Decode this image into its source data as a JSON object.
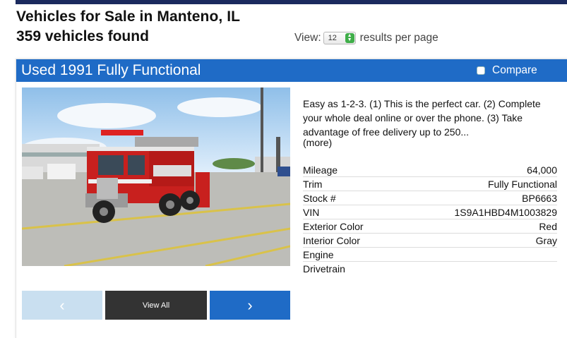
{
  "header": {
    "title": "Vehicles for Sale in Manteno, IL",
    "count": "359 vehicles found",
    "view_label": "View:",
    "per_page_value": "12",
    "per_page_suffix": "results per page"
  },
  "listing": {
    "title": "Used 1991 Fully Functional",
    "compare_label": "Compare",
    "description": "Easy as 1-2-3. (1) This is the perfect car. (2) Complete your whole deal online or over the phone. (3) Take advantage of free delivery up to 250...",
    "more_link": "(more)",
    "view_all_label": "View All",
    "specs": [
      {
        "label": "Mileage",
        "value": "64,000"
      },
      {
        "label": "Trim",
        "value": "Fully Functional"
      },
      {
        "label": "Stock #",
        "value": "BP6663"
      },
      {
        "label": "VIN",
        "value": "1S9A1HBD4M1003829"
      },
      {
        "label": "Exterior Color",
        "value": "Red"
      },
      {
        "label": "Interior Color",
        "value": "Gray"
      },
      {
        "label": "Engine",
        "value": ""
      },
      {
        "label": "Drivetrain",
        "value": ""
      }
    ]
  },
  "colors": {
    "brand_blue": "#1f6bc6",
    "dark_navy": "#1b2a5e",
    "nav_dark": "#333333",
    "nav_disabled": "#c9dff0"
  },
  "icons": {
    "prev": "chevron-left-icon",
    "next": "chevron-right-icon",
    "select_arrows": "updown-arrows-icon"
  }
}
